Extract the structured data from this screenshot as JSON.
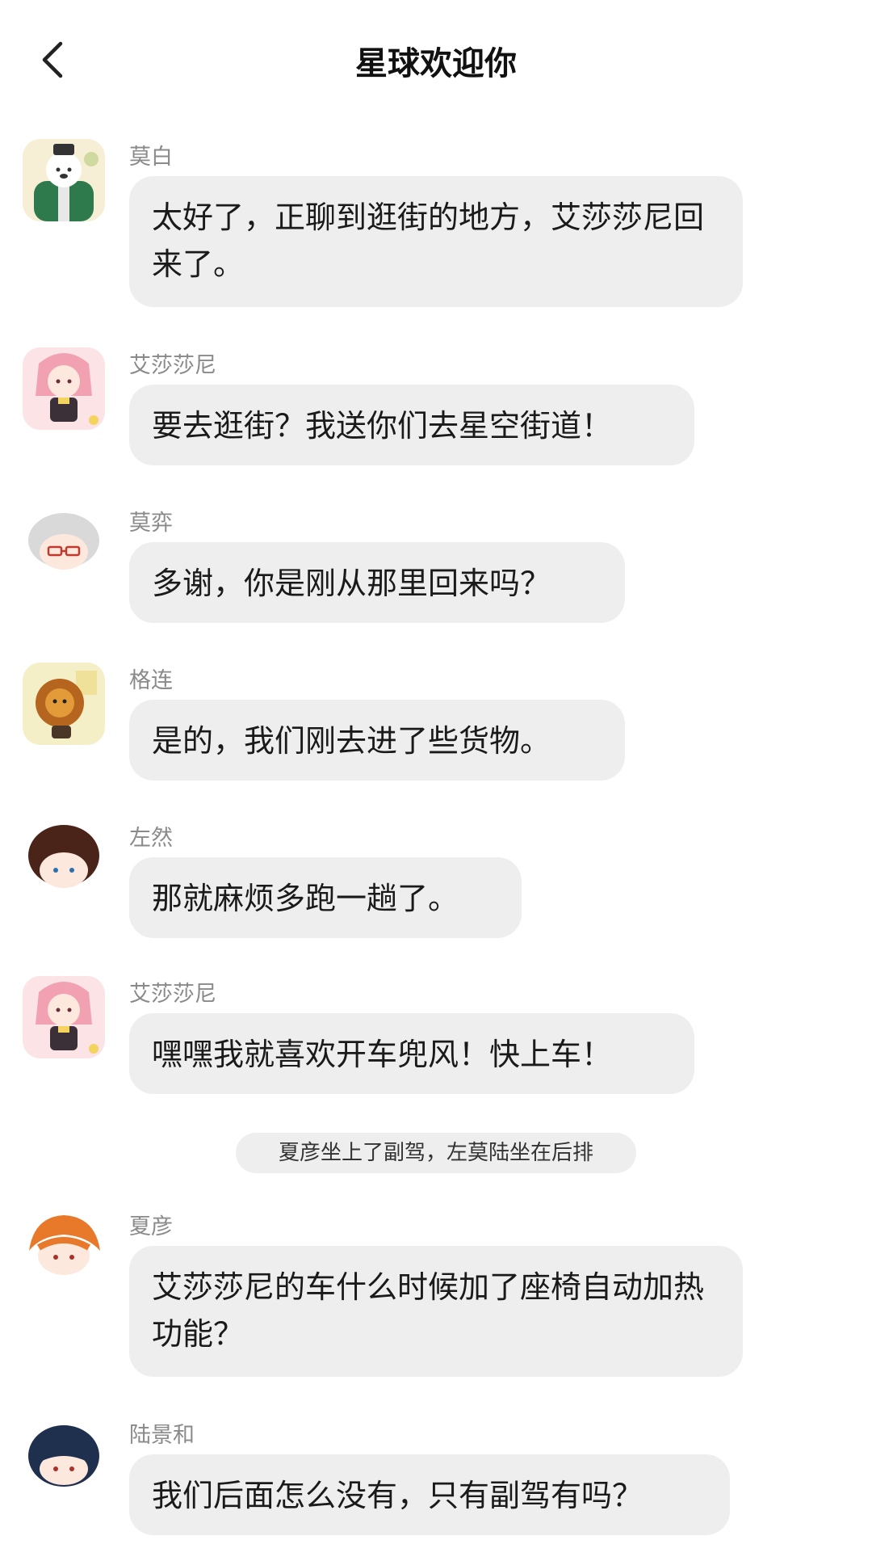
{
  "header": {
    "title": "星球欢迎你",
    "back_icon": "chevron-left-icon"
  },
  "messages": [
    {
      "sender": "莫白",
      "text": "太好了，正聊到逛街的地方，艾莎莎尼回来了。"
    },
    {
      "sender": "艾莎莎尼",
      "text": "要去逛街？我送你们去星空街道！"
    },
    {
      "sender": "莫弈",
      "text": "多谢，你是刚从那里回来吗？"
    },
    {
      "sender": "格连",
      "text": "是的，我们刚去进了些货物。"
    },
    {
      "sender": "左然",
      "text": "那就麻烦多跑一趟了。"
    },
    {
      "sender": "艾莎莎尼",
      "text": "嘿嘿我就喜欢开车兜风！快上车！"
    },
    {
      "sender": "夏彦",
      "text": "艾莎莎尼的车什么时候加了座椅自动加热功能？"
    },
    {
      "sender": "陆景和",
      "text": "我们后面怎么没有，只有副驾有吗？"
    }
  ],
  "system_notice": "夏彦坐上了副驾，左莫陆坐在后排",
  "colors": {
    "bubble": "#eeeeee",
    "sender": "#8a8a8a",
    "text": "#1a1a1a",
    "background": "#ffffff"
  }
}
